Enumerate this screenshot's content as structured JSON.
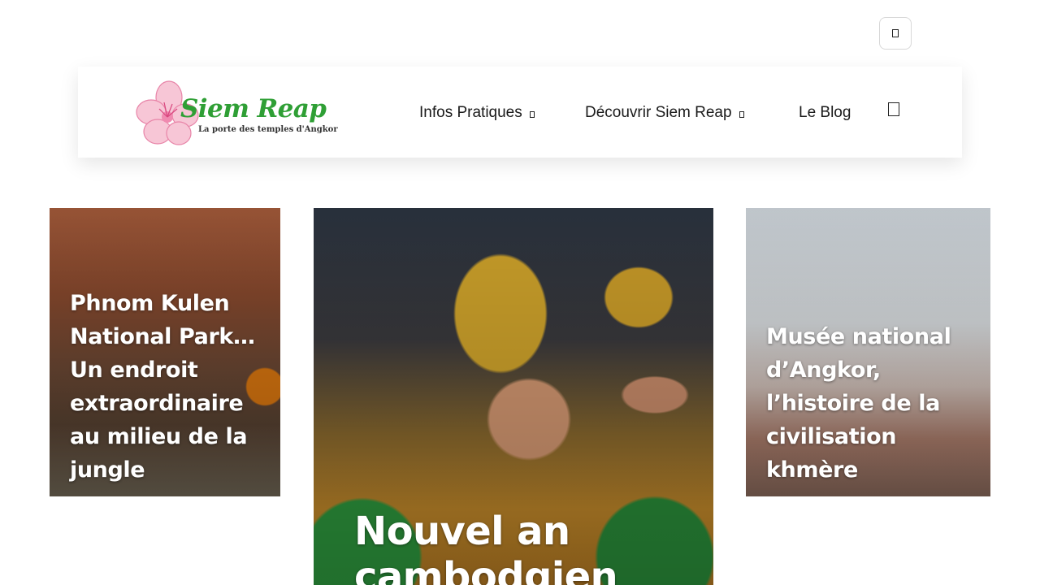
{
  "utility": {
    "toggle_icon": "square-outline-icon"
  },
  "logo": {
    "title": "Siem Reap",
    "tagline": "La porte des temples d'Angkor",
    "colors": {
      "text": "#2f9f35",
      "flower": "#e884a8"
    }
  },
  "nav": {
    "items": [
      {
        "label": "Infos Pratiques",
        "has_dropdown": true
      },
      {
        "label": "Découvrir Siem Reap",
        "has_dropdown": true
      },
      {
        "label": "Le Blog",
        "has_dropdown": false
      }
    ],
    "search_icon": "search-icon"
  },
  "cards": [
    {
      "title": "Phnom Kulen National Park… Un endroit extraordinaire au milieu de la jungle"
    },
    {
      "title": "Nouvel an cambodgien"
    },
    {
      "title": "Musée national d’Angkor, l’histoire de la civilisation khmère"
    }
  ]
}
